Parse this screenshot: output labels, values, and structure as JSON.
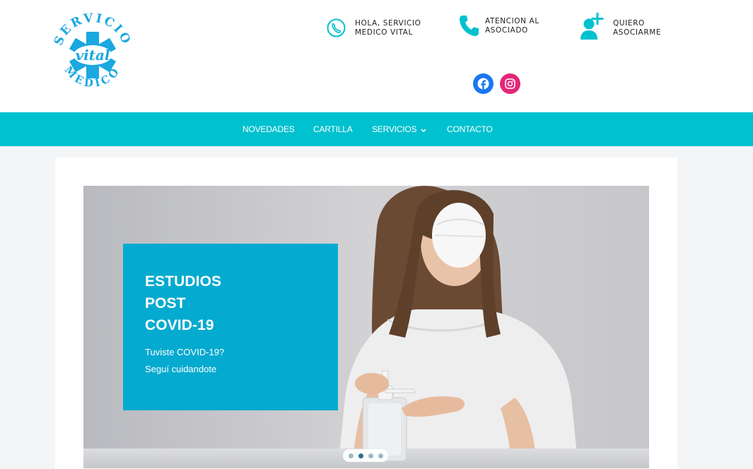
{
  "brand": {
    "logo_top_text": "SERVICIO",
    "logo_center_text": "vital",
    "logo_bottom_text": "MEDICO",
    "logo_color": "#1aa8e0"
  },
  "header": {
    "contacts": [
      {
        "icon": "phone-outline-icon",
        "line1": "HOLA, SERVICIO",
        "line2": "MEDICO VITAL"
      },
      {
        "icon": "phone-icon",
        "line1": "ATENCION AL",
        "line2": "ASOCIADO"
      },
      {
        "icon": "add-user-icon",
        "line1": "QUIERO",
        "line2": "ASOCIARME"
      }
    ],
    "social": [
      {
        "icon": "facebook-icon",
        "color": "#1877f2"
      },
      {
        "icon": "instagram-icon",
        "color": "#e4267a"
      }
    ],
    "accent_color": "#00c1cf"
  },
  "nav": {
    "items": [
      {
        "label": "NOVEDADES"
      },
      {
        "label": "CARTILLA"
      },
      {
        "label": "SERVICIOS",
        "has_dropdown": true
      },
      {
        "label": "CONTACTO"
      }
    ]
  },
  "slider": {
    "slide": {
      "title_lines": [
        "ESTUDIOS",
        "POST",
        "COVID-19"
      ],
      "subtitle_lines": [
        "Tuviste COVID-19?",
        "Seguí cuidandote"
      ],
      "box_color": "#04aacf"
    },
    "dots_count": 4,
    "active_dot": 2
  }
}
